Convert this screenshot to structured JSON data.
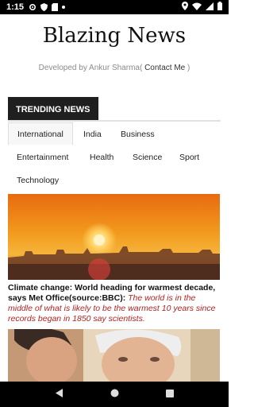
{
  "status_bar": {
    "time": "1:15"
  },
  "header": {
    "title": "Blazing News",
    "subtitle_prefix": "Developed by Ankur Sharma(",
    "contact_link": " Contact Me",
    "subtitle_suffix": " )"
  },
  "trending": {
    "heading": "TRENDING NEWS",
    "tabs": [
      "International",
      "India",
      "Business",
      "Entertainment",
      "Health",
      "Science",
      "Sport",
      "Technology"
    ],
    "active_tab": "International"
  },
  "articles": [
    {
      "title": "Climate change: World heading for warmest decade, says Met Office(source:BBC):",
      "description": "The world is in the middle of what is likely to be the warmest 10 years since records began in 1850 say scientists."
    }
  ],
  "colors": {
    "accent_dark": "#1f1f1f",
    "description_red": "#b22222"
  }
}
